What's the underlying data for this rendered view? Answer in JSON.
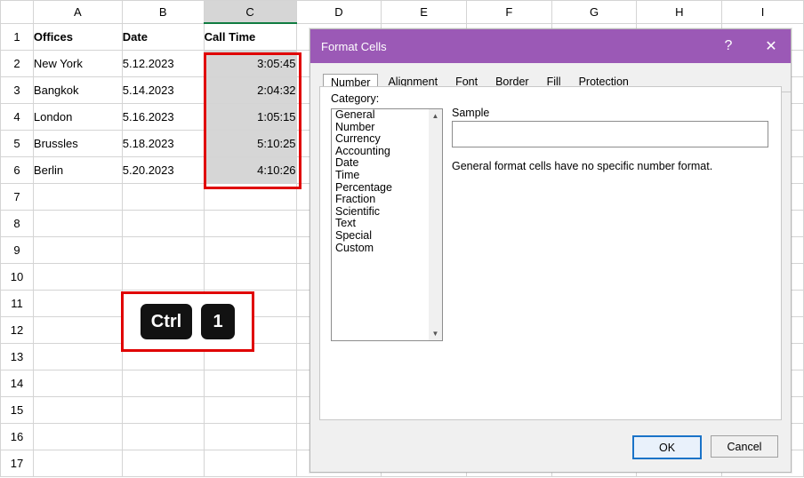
{
  "spreadsheet": {
    "column_headers": [
      "A",
      "B",
      "C",
      "D",
      "E",
      "F",
      "G",
      "H",
      "I"
    ],
    "row_headers": [
      "1",
      "2",
      "3",
      "4",
      "5",
      "6",
      "7",
      "8",
      "9",
      "10",
      "11",
      "12",
      "13",
      "14",
      "15",
      "16",
      "17"
    ],
    "selected_column": "C",
    "selection_range": "C2:C6",
    "rows": [
      {
        "A": "Offices",
        "B": "Date",
        "C": "Call Time"
      },
      {
        "A": "New York",
        "B": "5.12.2023",
        "C": "3:05:45"
      },
      {
        "A": "Bangkok",
        "B": "5.14.2023",
        "C": "2:04:32"
      },
      {
        "A": "London",
        "B": "5.16.2023",
        "C": "1:05:15"
      },
      {
        "A": "Brussles",
        "B": "5.18.2023",
        "C": "5:10:25"
      },
      {
        "A": "Berlin",
        "B": "5.20.2023",
        "C": "4:10:26"
      }
    ]
  },
  "shortcut": {
    "keys": [
      "Ctrl",
      "1"
    ]
  },
  "dialog": {
    "title": "Format Cells",
    "help_glyph": "?",
    "close_glyph": "✕",
    "tabs": [
      {
        "label": "Number",
        "active": true
      },
      {
        "label": "Alignment",
        "active": false
      },
      {
        "label": "Font",
        "active": false
      },
      {
        "label": "Border",
        "active": false
      },
      {
        "label": "Fill",
        "active": false
      },
      {
        "label": "Protection",
        "active": false
      }
    ],
    "category_label": "Category:",
    "categories": [
      "General",
      "Number",
      "Currency",
      "Accounting",
      "Date",
      "Time",
      "Percentage",
      "Fraction",
      "Scientific",
      "Text",
      "Special",
      "Custom"
    ],
    "sample_label": "Sample",
    "sample_value": "",
    "description": "General format cells have no specific number format.",
    "ok_label": "OK",
    "cancel_label": "Cancel",
    "scroll_up_glyph": "▲",
    "scroll_down_glyph": "▼"
  },
  "colors": {
    "dialog_title_bar": "#9b59b6",
    "selection_outline": "#e00000",
    "key_background": "#121212",
    "grid_line": "#d4d4d4",
    "selected_cell_fill": "#d6d6d6",
    "active_column_underline": "#107c41"
  }
}
